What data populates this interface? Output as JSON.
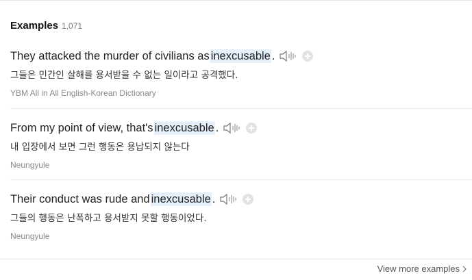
{
  "section": {
    "title": "Examples",
    "count": "1,071"
  },
  "examples": [
    {
      "before": "They attacked the murder of civilians as ",
      "keyword": "inexcusable",
      "after": ".",
      "translation": "그들은 민간인 살해를 용서받을 수 없는 일이라고 공격했다.",
      "source": "YBM All in All English-Korean Dictionary"
    },
    {
      "before": "From my point of view, that's ",
      "keyword": "inexcusable",
      "after": ".",
      "translation": "내 입장에서 보면 그런 행동은 용납되지 않는다",
      "source": "Neungyule"
    },
    {
      "before": "Their conduct was rude and ",
      "keyword": "inexcusable",
      "after": ".",
      "translation": "그들의 행동은 난폭하고 용서받지 못할 행동이었다.",
      "source": "Neungyule"
    }
  ],
  "footer": {
    "view_more": "View more examples"
  },
  "icons": {
    "speaker": "speaker-icon",
    "add": "plus-icon",
    "chevron": "chevron-right-icon"
  },
  "colors": {
    "highlight": "#e6f0fb",
    "source_text": "#8a8a8a"
  }
}
